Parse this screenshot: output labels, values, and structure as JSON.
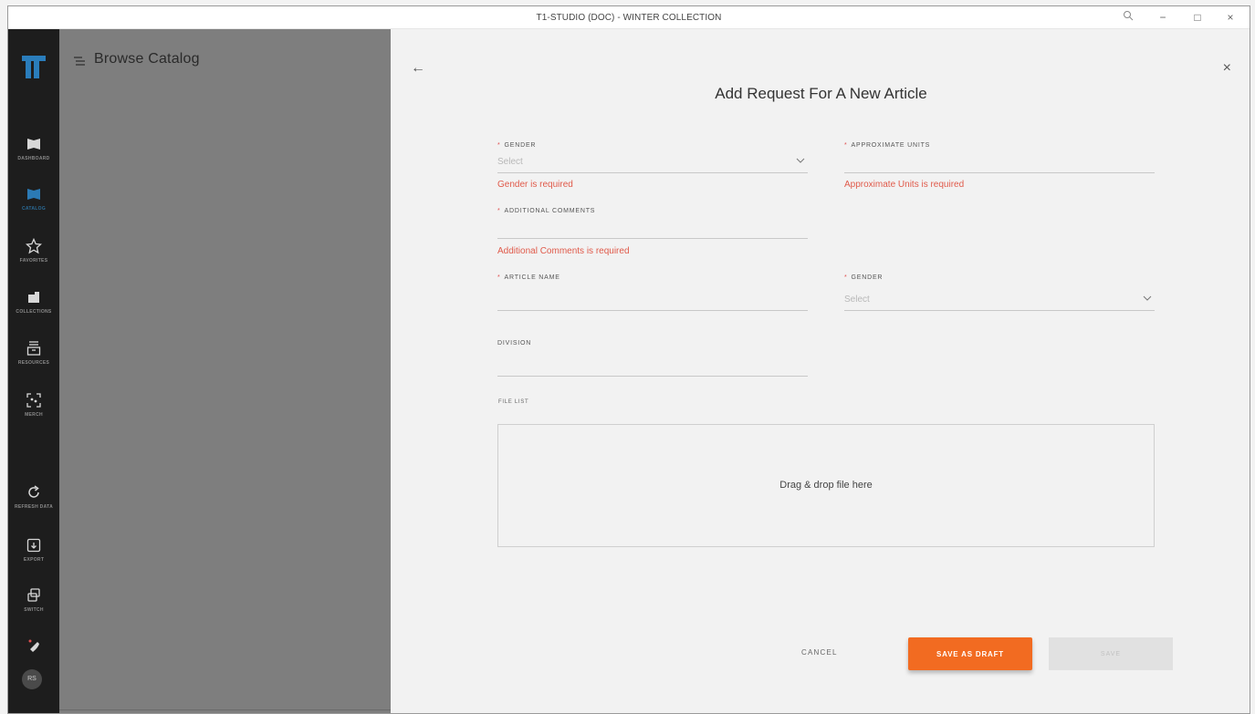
{
  "window": {
    "title": "T1-STUDIO (DOC) - WINTER COLLECTION",
    "controls": {
      "search": "🔍",
      "minimize": "−",
      "maximize": "□",
      "close": "×"
    }
  },
  "sidebar": {
    "items": [
      {
        "label": "DASHBOARD",
        "icon": "dashboard-icon",
        "active": false
      },
      {
        "label": "CATALOG",
        "icon": "catalog-icon",
        "active": true
      },
      {
        "label": "FAVORITES",
        "icon": "star-icon",
        "active": false
      },
      {
        "label": "COLLECTIONS",
        "icon": "collections-icon",
        "active": false
      },
      {
        "label": "RESOURCES",
        "icon": "resources-icon",
        "active": false
      },
      {
        "label": "MERCH",
        "icon": "merch-icon",
        "active": false
      },
      {
        "label": "REFRESH DATA",
        "icon": "refresh-icon",
        "active": false
      },
      {
        "label": "EXPORT",
        "icon": "export-icon",
        "active": false
      },
      {
        "label": "SWITCH",
        "icon": "switch-icon",
        "active": false
      }
    ],
    "avatar": "RS",
    "accent_color": "#2b6c99"
  },
  "browse": {
    "title": "Browse Catalog"
  },
  "form": {
    "back": "←",
    "close": "×",
    "heading": "Add Request For A New Article",
    "fields": {
      "gender1": {
        "label": "GENDER",
        "placeholder": "Select",
        "error": "Gender is required"
      },
      "approx_units": {
        "label": "APPROXIMATE UNITS",
        "error": "Approximate Units is required"
      },
      "additional_comments": {
        "label": "ADDITIONAL COMMENTS",
        "error": "Additional Comments is required"
      },
      "article_name": {
        "label": "ARTICLE NAME"
      },
      "gender2": {
        "label": "GENDER",
        "placeholder": "Select"
      },
      "division": {
        "label": "DIVISION"
      }
    },
    "required_mark": "*",
    "file_list_label": "FILE LIST",
    "dropzone_text": "Drag & drop file here",
    "buttons": {
      "cancel": "CANCEL",
      "save_draft": "SAVE AS DRAFT",
      "save": "SAVE"
    },
    "colors": {
      "primary": "#f26b21",
      "error": "#e05a4a"
    }
  }
}
